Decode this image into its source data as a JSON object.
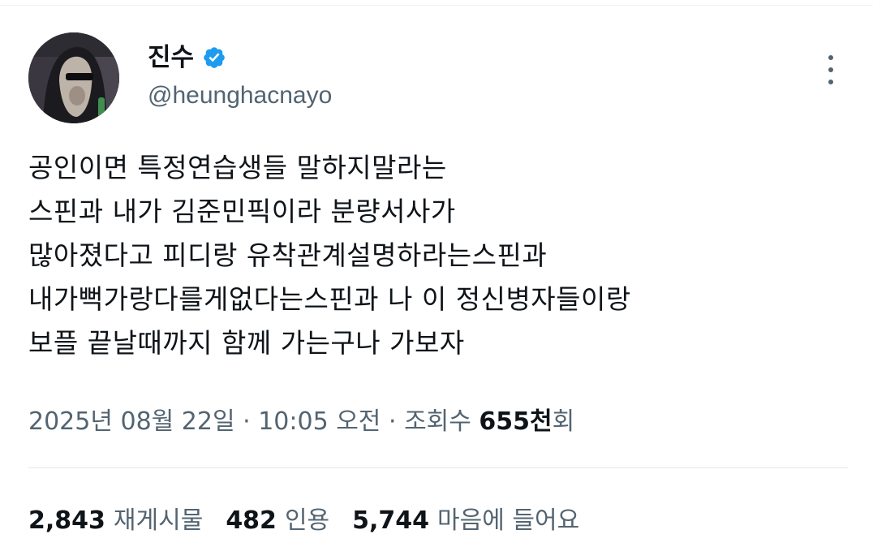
{
  "author": {
    "display_name": "진수",
    "handle": "@heunghacnayo",
    "verified": true
  },
  "tweet": {
    "lines": [
      "공인이면 특정연습생들 말하지말라는",
      "스핀과 내가 김준민픽이라 분량서사가",
      "많아졌다고 피디랑 유착관계설명하라는스핀과",
      "내가뻑가랑다를게없다는스핀과 나 이 정신병자들이랑",
      "보플 끝날때까지 함께 가는구나 가보자"
    ]
  },
  "meta": {
    "date": "2025년 08월 22일",
    "separator": "·",
    "time": "10:05 오전",
    "views_label": "조회수",
    "views_count": "655천",
    "views_suffix": "회"
  },
  "stats": {
    "retweets_count": "2,843",
    "retweets_label": "재게시물",
    "quotes_count": "482",
    "quotes_label": "인용",
    "likes_count": "5,744",
    "likes_label": "마음에 들어요"
  },
  "colors": {
    "text": "#0f1419",
    "secondary": "#536471",
    "verified": "#1d9bf0",
    "divider": "#e1e8ed"
  },
  "icons": [
    "verified-badge-icon",
    "more-options-icon"
  ]
}
